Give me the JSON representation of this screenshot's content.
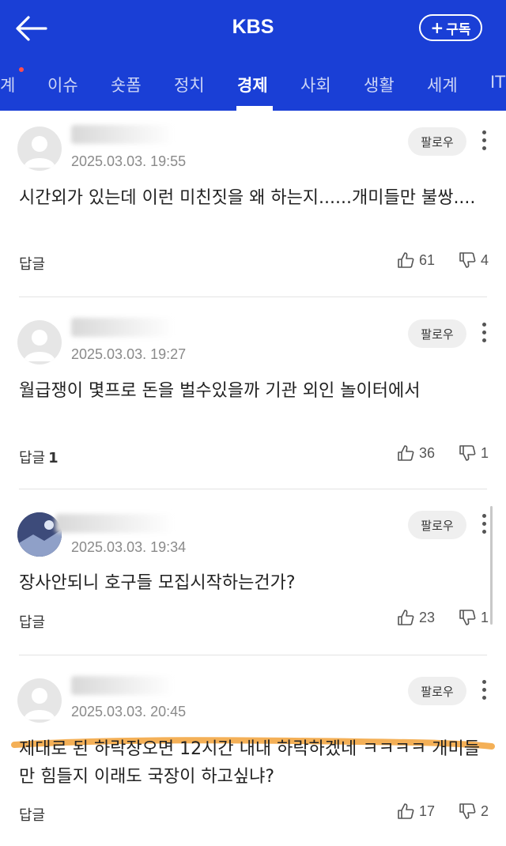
{
  "header": {
    "title": "KBS",
    "subscribe_label": "구독"
  },
  "tabs": [
    {
      "label": "계"
    },
    {
      "label": "이슈"
    },
    {
      "label": "숏폼"
    },
    {
      "label": "정치"
    },
    {
      "label": "경제",
      "active": true
    },
    {
      "label": "사회"
    },
    {
      "label": "생활"
    },
    {
      "label": "세계"
    },
    {
      "label": "IT"
    }
  ],
  "colors": {
    "brand": "#1a3fd6",
    "highlight": "#f2a23a"
  },
  "comments": [
    {
      "date": "2025.03.03. 19:55",
      "follow_label": "팔로우",
      "text": "시간외가 있는데 이런 미친짓을 왜 하는지......개미들만 불쌍....",
      "reply_label": "답글",
      "reply_count": "",
      "likes": "61",
      "dislikes": "4"
    },
    {
      "date": "2025.03.03. 19:27",
      "follow_label": "팔로우",
      "text": "월급쟁이 몇프로 돈을 벌수있을까 기관 외인 놀이터에서",
      "reply_label": "답글",
      "reply_count": "1",
      "likes": "36",
      "dislikes": "1"
    },
    {
      "date": "2025.03.03. 19:34",
      "follow_label": "팔로우",
      "text": "장사안되니 호구들 모집시작하는건가?",
      "reply_label": "답글",
      "reply_count": "",
      "likes": "23",
      "dislikes": "1"
    },
    {
      "date": "2025.03.03. 20:45",
      "follow_label": "팔로우",
      "text": "제대로 된 하락장오면 12시간 내내 하락하겠네 ㅋㅋㅋㅋ 개미들만 힘들지 이래도 국장이 하고싶냐?",
      "reply_label": "답글",
      "reply_count": "",
      "likes": "17",
      "dislikes": "2"
    }
  ]
}
